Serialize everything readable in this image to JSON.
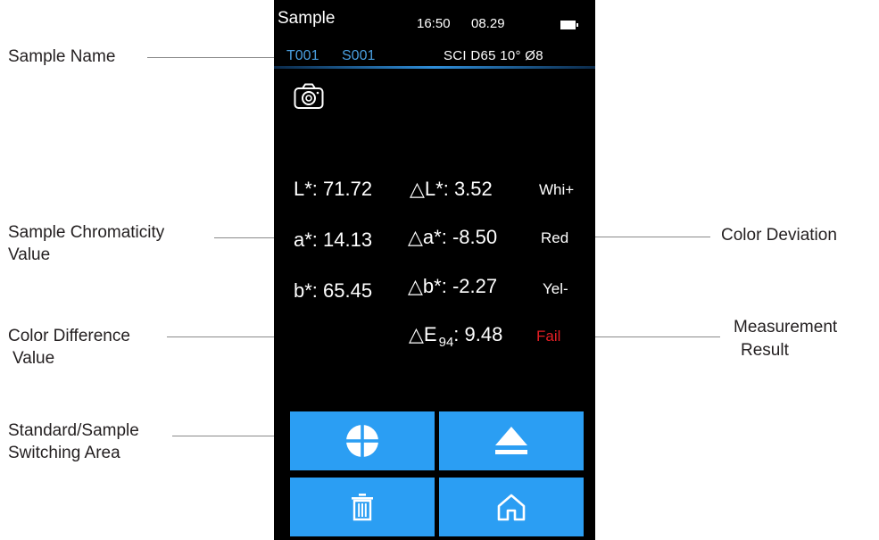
{
  "device": {
    "status_bar": {
      "title": "Sample",
      "time": "16:50",
      "date": "08.29",
      "battery_icon": "battery-icon"
    },
    "sample_header": {
      "standard_id": "T001",
      "sample_id": "S001",
      "measurement_conditions": "SCI D65 10° Ø8"
    },
    "camera_icon": "camera-icon",
    "measurements": {
      "L_value": "L*: 71.72",
      "a_value": "a*: 14.13",
      "b_value": "b*: 65.45",
      "dL_value": "L*: 3.52",
      "da_value": "a*: -8.50",
      "db_value": "b*: -2.27",
      "dE_label": "E",
      "dE_subscript": "94",
      "dE_value": ": 9.48",
      "delta_symbol": "△"
    },
    "deviations": {
      "L": "Whi+",
      "a": "Red",
      "b": "Yel-"
    },
    "result": {
      "text": "Fail",
      "color": "#e31e24"
    },
    "buttons": [
      {
        "icon": "crosshair-circle-icon"
      },
      {
        "icon": "eject-icon"
      },
      {
        "icon": "trash-icon"
      },
      {
        "icon": "home-icon"
      }
    ],
    "accent_color": "#2b9ef3"
  },
  "annotations": {
    "sample_name": "Sample Name",
    "chromaticity_line1": "Sample Chromaticity",
    "chromaticity_line2": "Value",
    "color_difference_line1": "Color Difference",
    "color_difference_line2": "Value",
    "switching_line1": "Standard/Sample",
    "switching_line2": "Switching Area",
    "color_deviation": "Color Deviation",
    "result_line1": "Measurement",
    "result_line2": "Result"
  }
}
